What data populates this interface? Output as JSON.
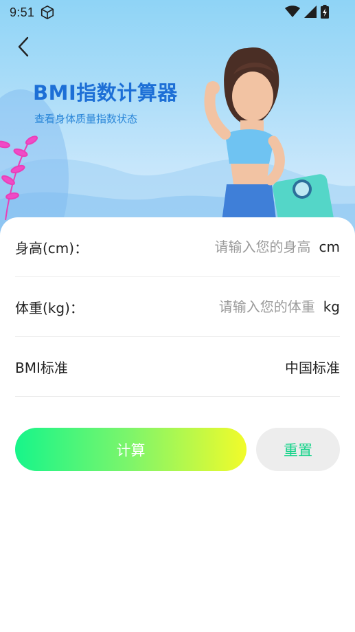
{
  "status_bar": {
    "time": "9:51"
  },
  "header": {
    "title": "BMI指数计算器",
    "subtitle": "查看身体质量指数状态"
  },
  "form": {
    "height": {
      "label": "身高(cm)：",
      "placeholder": "请输入您的身高",
      "unit": "cm"
    },
    "weight": {
      "label": "体重(kg)：",
      "placeholder": "请输入您的体重",
      "unit": "kg"
    },
    "standard": {
      "label": "BMI标准",
      "value": "中国标准"
    }
  },
  "buttons": {
    "calculate": "计算",
    "reset": "重置"
  },
  "colors": {
    "accent_green": "#16d38a",
    "title_blue": "#1d6fd6",
    "gradient_start": "#17f58a",
    "gradient_end": "#f2fb2a"
  }
}
